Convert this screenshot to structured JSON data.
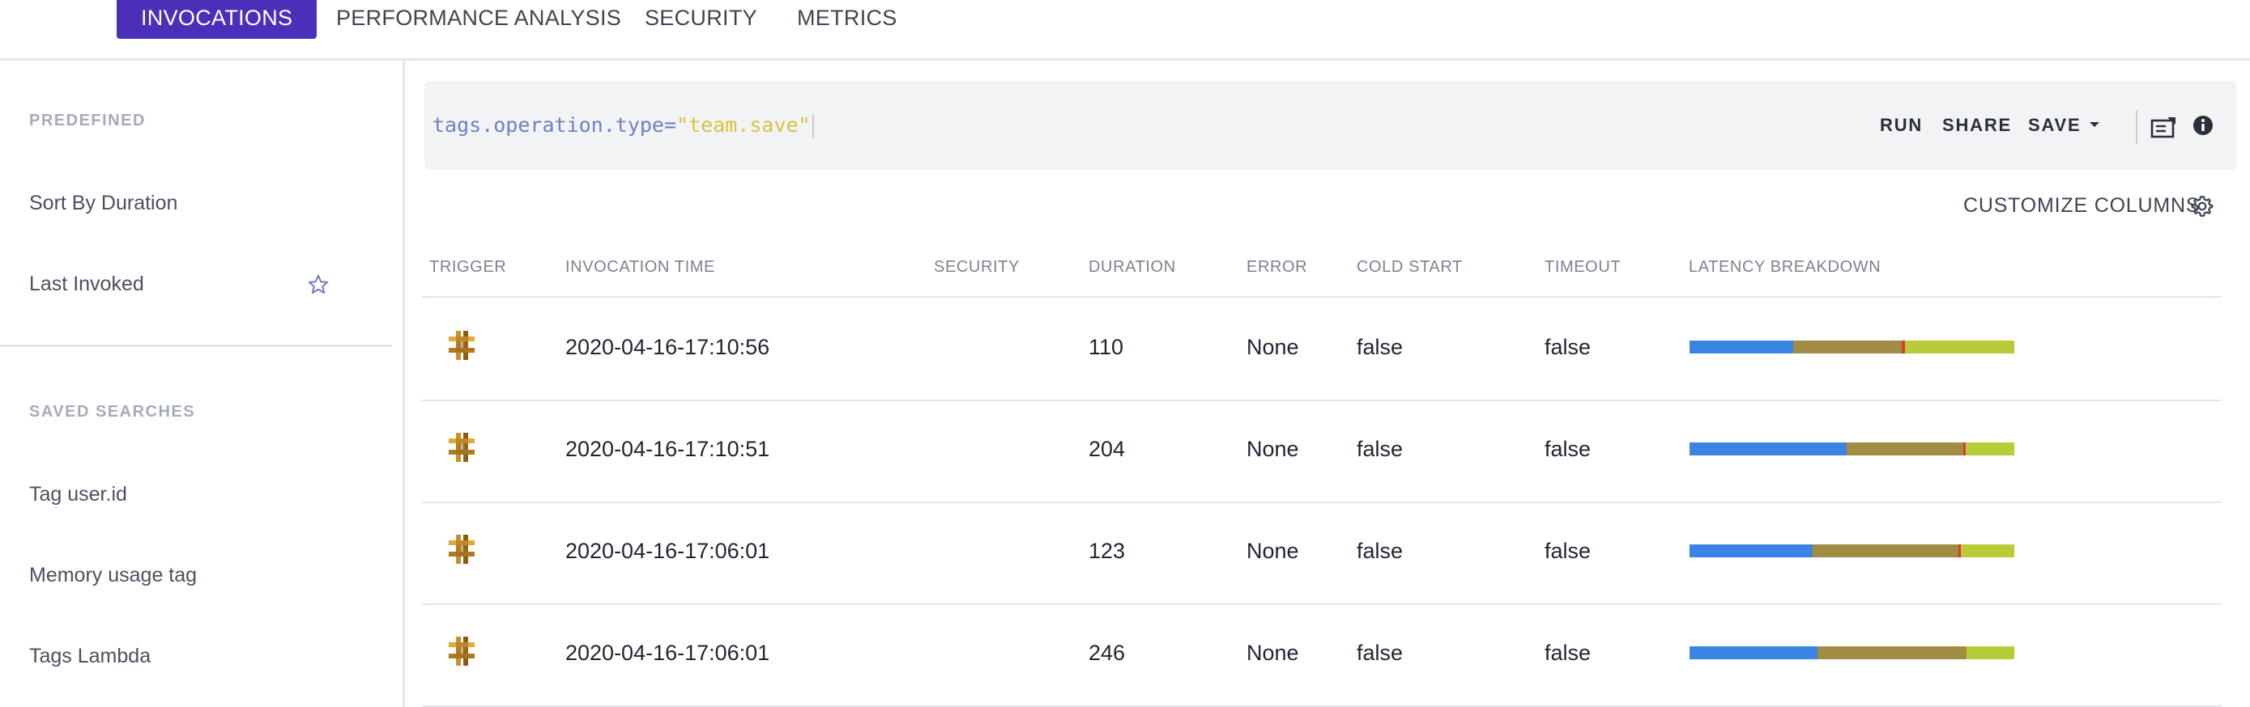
{
  "tabs": [
    {
      "label": "INVOCATIONS",
      "active": true
    },
    {
      "label": "PERFORMANCE ANALYSIS",
      "active": false
    },
    {
      "label": "SECURITY",
      "active": false
    },
    {
      "label": "METRICS",
      "active": false
    }
  ],
  "sidebar": {
    "predefined_title": "PREDEFINED",
    "predefined": [
      {
        "label": "Sort By Duration"
      },
      {
        "label": "Last Invoked",
        "icon": "star-icon"
      }
    ],
    "saved_title": "SAVED SEARCHES",
    "saved": [
      {
        "label": "Tag user.id"
      },
      {
        "label": "Memory usage tag"
      },
      {
        "label": "Tags Lambda"
      }
    ]
  },
  "query": {
    "key": "tags.operation.type",
    "operator": "=",
    "value": "\"team.save\""
  },
  "query_actions": {
    "run": "RUN",
    "share": "SHARE",
    "save": "SAVE",
    "icons": [
      "notes-icon",
      "info-icon"
    ]
  },
  "customize_columns": "CUSTOMIZE COLUMNS",
  "colors": {
    "accent": "#4b2fb8",
    "latency_segments": [
      "#3b84e4",
      "#a08c42",
      "#e0363b",
      "#b7cc36"
    ]
  },
  "table": {
    "columns": [
      "TRIGGER",
      "INVOCATION TIME",
      "SECURITY",
      "DURATION",
      "ERROR",
      "COLD START",
      "TIMEOUT",
      "LATENCY BREAKDOWN"
    ],
    "rows": [
      {
        "trigger_icon": "aws-trigger-icon",
        "time": "2020-04-16-17:10:56",
        "security": "",
        "duration": "110",
        "error": "None",
        "cold_start": "false",
        "timeout": "false",
        "latency": [
          0.32,
          0.335,
          0.01,
          0.335
        ]
      },
      {
        "trigger_icon": "aws-trigger-icon",
        "time": "2020-04-16-17:10:51",
        "security": "",
        "duration": "204",
        "error": "None",
        "cold_start": "false",
        "timeout": "false",
        "latency": [
          0.485,
          0.36,
          0.008,
          0.147
        ]
      },
      {
        "trigger_icon": "aws-trigger-icon",
        "time": "2020-04-16-17:06:01",
        "security": "",
        "duration": "123",
        "error": "None",
        "cold_start": "false",
        "timeout": "false",
        "latency": [
          0.38,
          0.45,
          0.008,
          0.162
        ]
      },
      {
        "trigger_icon": "aws-trigger-icon",
        "time": "2020-04-16-17:06:01",
        "security": "",
        "duration": "246",
        "error": "None",
        "cold_start": "false",
        "timeout": "false",
        "latency": [
          0.395,
          0.46,
          0.0,
          0.145
        ]
      }
    ]
  }
}
